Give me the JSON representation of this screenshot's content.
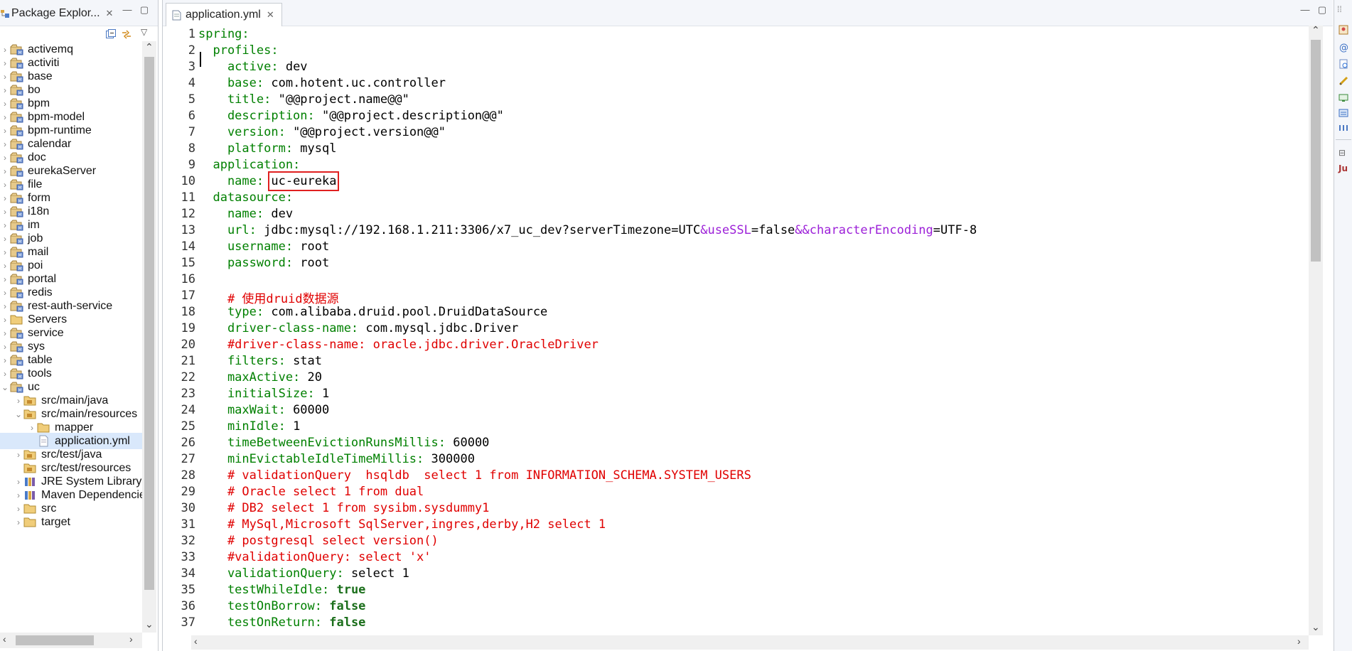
{
  "package_explorer": {
    "tab_title": "Package Explor...",
    "tree": [
      {
        "label": "activemq",
        "type": "project",
        "depth": 0,
        "expanded": false
      },
      {
        "label": "activiti",
        "type": "project",
        "depth": 0,
        "expanded": false
      },
      {
        "label": "base",
        "type": "project",
        "depth": 0,
        "expanded": false
      },
      {
        "label": "bo",
        "type": "project",
        "depth": 0,
        "expanded": false
      },
      {
        "label": "bpm",
        "type": "project",
        "depth": 0,
        "expanded": false
      },
      {
        "label": "bpm-model",
        "type": "project",
        "depth": 0,
        "expanded": false
      },
      {
        "label": "bpm-runtime",
        "type": "project",
        "depth": 0,
        "expanded": false
      },
      {
        "label": "calendar",
        "type": "project",
        "depth": 0,
        "expanded": false
      },
      {
        "label": "doc",
        "type": "project",
        "depth": 0,
        "expanded": false
      },
      {
        "label": "eurekaServer",
        "type": "project",
        "depth": 0,
        "expanded": false
      },
      {
        "label": "file",
        "type": "project",
        "depth": 0,
        "expanded": false
      },
      {
        "label": "form",
        "type": "project",
        "depth": 0,
        "expanded": false
      },
      {
        "label": "i18n",
        "type": "project",
        "depth": 0,
        "expanded": false
      },
      {
        "label": "im",
        "type": "project",
        "depth": 0,
        "expanded": false
      },
      {
        "label": "job",
        "type": "project",
        "depth": 0,
        "expanded": false
      },
      {
        "label": "mail",
        "type": "project",
        "depth": 0,
        "expanded": false
      },
      {
        "label": "poi",
        "type": "project",
        "depth": 0,
        "expanded": false
      },
      {
        "label": "portal",
        "type": "project",
        "depth": 0,
        "expanded": false
      },
      {
        "label": "redis",
        "type": "project",
        "depth": 0,
        "expanded": false
      },
      {
        "label": "rest-auth-service",
        "type": "project",
        "depth": 0,
        "expanded": false
      },
      {
        "label": "Servers",
        "type": "folder",
        "depth": 0,
        "expanded": false
      },
      {
        "label": "service",
        "type": "project",
        "depth": 0,
        "expanded": false
      },
      {
        "label": "sys",
        "type": "project",
        "depth": 0,
        "expanded": false
      },
      {
        "label": "table",
        "type": "project",
        "depth": 0,
        "expanded": false
      },
      {
        "label": "tools",
        "type": "project",
        "depth": 0,
        "expanded": false
      },
      {
        "label": "uc",
        "type": "project",
        "depth": 0,
        "expanded": true
      },
      {
        "label": "src/main/java",
        "type": "srcfolder",
        "depth": 1,
        "expanded": false
      },
      {
        "label": "src/main/resources",
        "type": "srcfolder",
        "depth": 1,
        "expanded": true
      },
      {
        "label": "mapper",
        "type": "folder",
        "depth": 2,
        "expanded": false
      },
      {
        "label": "application.yml",
        "type": "file",
        "depth": 2,
        "expanded": null,
        "selected": true
      },
      {
        "label": "src/test/java",
        "type": "srcfolder",
        "depth": 1,
        "expanded": false
      },
      {
        "label": "src/test/resources",
        "type": "srcfolder",
        "depth": 1,
        "expanded": null
      },
      {
        "label": "JRE System Library [",
        "type": "library",
        "depth": 1,
        "expanded": false
      },
      {
        "label": "Maven Dependencie",
        "type": "library",
        "depth": 1,
        "expanded": false
      },
      {
        "label": "src",
        "type": "folder",
        "depth": 1,
        "expanded": false
      },
      {
        "label": "target",
        "type": "folder",
        "depth": 1,
        "expanded": false
      }
    ]
  },
  "editor": {
    "tab_title": "application.yml",
    "highlighted_value": "uc-eureka",
    "lines": [
      [
        [
          "k",
          "spring:"
        ]
      ],
      [
        [
          "k",
          "  profiles:"
        ]
      ],
      [
        [
          "k",
          "    active: "
        ],
        [
          "v",
          "dev"
        ]
      ],
      [
        [
          "k",
          "    base: "
        ],
        [
          "v",
          "com.hotent.uc.controller"
        ]
      ],
      [
        [
          "k",
          "    title: "
        ],
        [
          "v",
          "\"@@project.name@@\""
        ]
      ],
      [
        [
          "k",
          "    description: "
        ],
        [
          "v",
          "\"@@project.description@@\""
        ]
      ],
      [
        [
          "k",
          "    version: "
        ],
        [
          "v",
          "\"@@project.version@@\""
        ]
      ],
      [
        [
          "k",
          "    platform: "
        ],
        [
          "v",
          "mysql"
        ]
      ],
      [
        [
          "k",
          "  application:"
        ]
      ],
      [
        [
          "k",
          "    name: "
        ],
        [
          "hl",
          "uc-eureka"
        ]
      ],
      [
        [
          "k",
          "  datasource:"
        ]
      ],
      [
        [
          "k",
          "    name: "
        ],
        [
          "v",
          "dev"
        ]
      ],
      [
        [
          "k",
          "    url: "
        ],
        [
          "v",
          "jdbc:mysql://192.168.1.211:3306/x7_uc_dev?serverTimezone=UTC"
        ],
        [
          "p",
          "&useSSL"
        ],
        [
          "v",
          "=false"
        ],
        [
          "p",
          "&&characterEncoding"
        ],
        [
          "v",
          "=UTF-8"
        ]
      ],
      [
        [
          "k",
          "    username: "
        ],
        [
          "v",
          "root"
        ]
      ],
      [
        [
          "k",
          "    password: "
        ],
        [
          "v",
          "root"
        ]
      ],
      [],
      [
        [
          "c",
          "    # 使用druid数据源"
        ]
      ],
      [
        [
          "k",
          "    type: "
        ],
        [
          "v",
          "com.alibaba.druid.pool.DruidDataSource"
        ]
      ],
      [
        [
          "k",
          "    driver-class-name: "
        ],
        [
          "v",
          "com.mysql.jdbc.Driver"
        ]
      ],
      [
        [
          "c",
          "    #driver-class-name: oracle.jdbc.driver.OracleDriver"
        ]
      ],
      [
        [
          "k",
          "    filters: "
        ],
        [
          "v",
          "stat"
        ]
      ],
      [
        [
          "k",
          "    maxActive: "
        ],
        [
          "v",
          "20"
        ]
      ],
      [
        [
          "k",
          "    initialSize: "
        ],
        [
          "v",
          "1"
        ]
      ],
      [
        [
          "k",
          "    maxWait: "
        ],
        [
          "v",
          "60000"
        ]
      ],
      [
        [
          "k",
          "    minIdle: "
        ],
        [
          "v",
          "1"
        ]
      ],
      [
        [
          "k",
          "    timeBetweenEvictionRunsMillis: "
        ],
        [
          "v",
          "60000"
        ]
      ],
      [
        [
          "k",
          "    minEvictableIdleTimeMillis: "
        ],
        [
          "v",
          "300000"
        ]
      ],
      [
        [
          "c",
          "    # validationQuery  hsqldb  select 1 from INFORMATION_SCHEMA.SYSTEM_USERS"
        ]
      ],
      [
        [
          "c",
          "    # Oracle select 1 from dual"
        ]
      ],
      [
        [
          "c",
          "    # DB2 select 1 from sysibm.sysdummy1"
        ]
      ],
      [
        [
          "c",
          "    # MySql,Microsoft SqlServer,ingres,derby,H2 select 1"
        ]
      ],
      [
        [
          "c",
          "    # postgresql select version()"
        ]
      ],
      [
        [
          "c",
          "    #validationQuery: select 'x'"
        ]
      ],
      [
        [
          "k",
          "    validationQuery: "
        ],
        [
          "v",
          "select 1"
        ]
      ],
      [
        [
          "k",
          "    testWhileIdle: "
        ],
        [
          "b",
          "true"
        ]
      ],
      [
        [
          "k",
          "    testOnBorrow: "
        ],
        [
          "b",
          "false"
        ]
      ],
      [
        [
          "k",
          "    testOnReturn: "
        ],
        [
          "b",
          "false"
        ]
      ]
    ]
  },
  "colors": {
    "key": "#008000",
    "value": "#000000",
    "comment": "#e00000",
    "entity": "#9c20d8",
    "boolean": "#1a6e1a",
    "highlight_box": "#e02020"
  }
}
